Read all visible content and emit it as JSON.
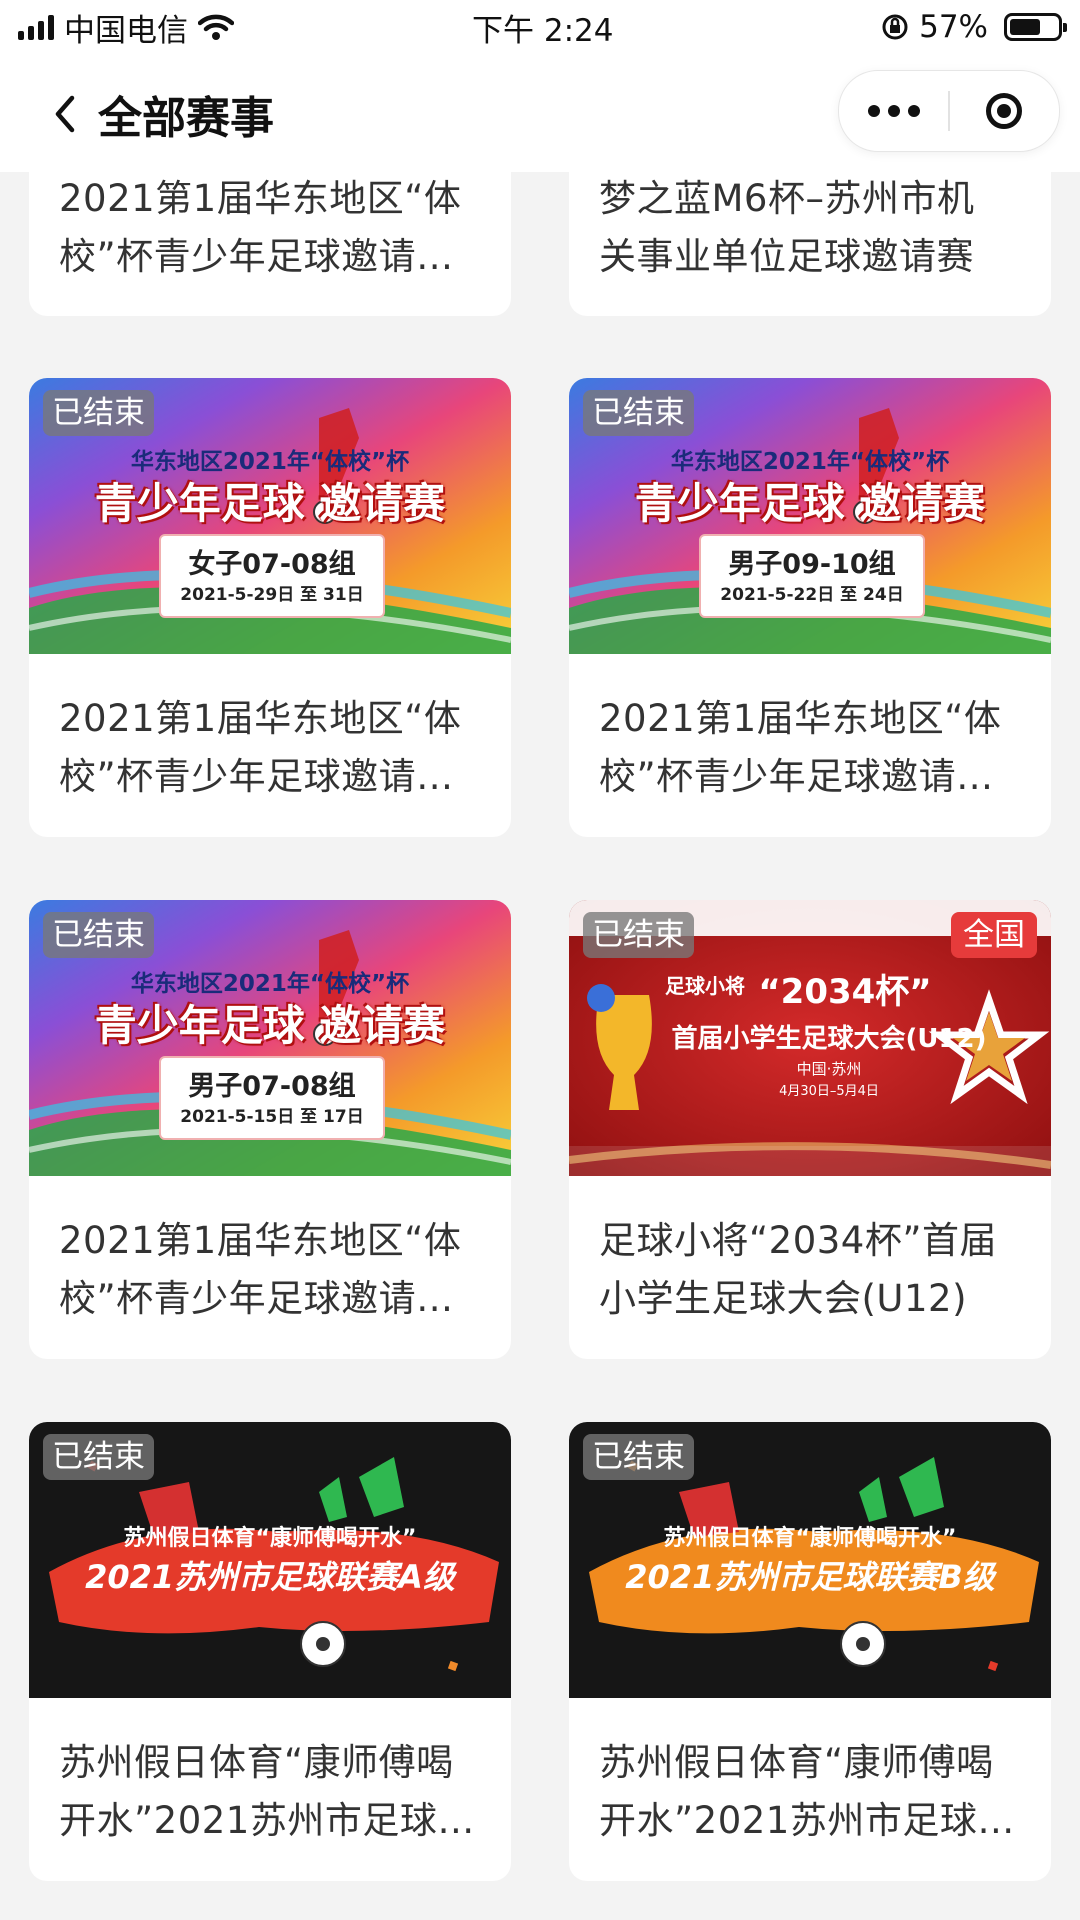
{
  "status_bar": {
    "carrier": "中国电信",
    "time": "下午 2:24",
    "battery_percent": "57%",
    "battery_level": 0.57
  },
  "nav": {
    "title": "全部赛事"
  },
  "cards": [
    {
      "title_line1": "2021第1届华东地区“体",
      "title_line2": "校”杯青少年足球邀请…"
    },
    {
      "title_line1": "梦之蓝M6杯–苏州市机",
      "title_line2": "关事业单位足球邀请赛"
    },
    {
      "badge": "已结束",
      "poster_top": "华东地区2021年“体校”杯",
      "poster_main": "青少年足球 邀请赛",
      "poster_group": "女子07-08组",
      "poster_date": "2021-5-29日 至 31日",
      "title_line1": "2021第1届华东地区“体",
      "title_line2": "校”杯青少年足球邀请…"
    },
    {
      "badge": "已结束",
      "poster_top": "华东地区2021年“体校”杯",
      "poster_main": "青少年足球 邀请赛",
      "poster_group": "男子09-10组",
      "poster_date": "2021-5-22日 至 24日",
      "title_line1": "2021第1届华东地区“体",
      "title_line2": "校”杯青少年足球邀请…"
    },
    {
      "badge": "已结束",
      "poster_top": "华东地区2021年“体校”杯",
      "poster_main": "青少年足球 邀请赛",
      "poster_group": "男子07-08组",
      "poster_date": "2021-5-15日 至 17日",
      "title_line1": "2021第1届华东地区“体",
      "title_line2": "校”杯青少年足球邀请…"
    },
    {
      "badge": "已结束",
      "region": "全国",
      "poster_brand": "足球小将",
      "poster_cup": "“2034杯”",
      "poster_main": "首届小学生足球大会(U12)",
      "poster_place": "中国·苏州",
      "poster_date": "4月30日–5月4日",
      "title_line1": "足球小将“2034杯”首届",
      "title_line2": "小学生足球大会(U12)"
    },
    {
      "badge": "已结束",
      "poster_top": "苏州假日体育“康师傅喝开水”",
      "poster_main": "2021苏州市足球联赛A级",
      "title_line1": "苏州假日体育“康师傅喝",
      "title_line2": "开水”2021苏州市足球…"
    },
    {
      "badge": "已结束",
      "poster_top": "苏州假日体育“康师傅喝开水”",
      "poster_main": "2021苏州市足球联赛B级",
      "title_line1": "苏州假日体育“康师傅喝",
      "title_line2": "开水”2021苏州市足球…"
    }
  ]
}
